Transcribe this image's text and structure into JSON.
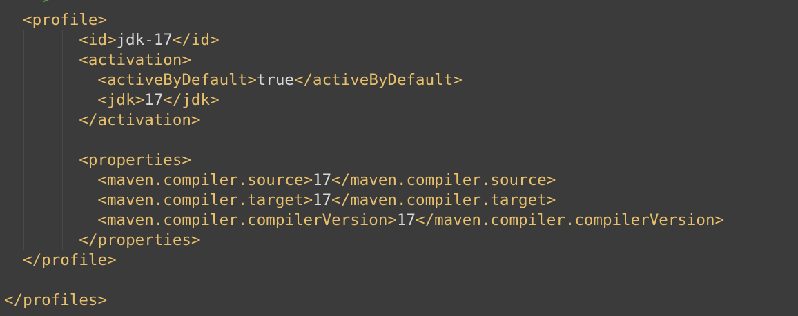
{
  "comment_tail": "-->",
  "lines": [
    {
      "indent": "  ",
      "open": "<profile>",
      "text": "",
      "close": ""
    },
    {
      "indent": "        ",
      "open": "<id>",
      "text": "jdk-17",
      "close": "</id>"
    },
    {
      "indent": "        ",
      "open": "<activation>",
      "text": "",
      "close": ""
    },
    {
      "indent": "          ",
      "open": "<activeByDefault>",
      "text": "true",
      "close": "</activeByDefault>"
    },
    {
      "indent": "          ",
      "open": "<jdk>",
      "text": "17",
      "close": "</jdk>"
    },
    {
      "indent": "        ",
      "open": "</activation>",
      "text": "",
      "close": ""
    },
    {
      "indent": "",
      "open": "",
      "text": "",
      "close": ""
    },
    {
      "indent": "        ",
      "open": "<properties>",
      "text": "",
      "close": ""
    },
    {
      "indent": "          ",
      "open": "<maven.compiler.source>",
      "text": "17",
      "close": "</maven.compiler.source>"
    },
    {
      "indent": "          ",
      "open": "<maven.compiler.target>",
      "text": "17",
      "close": "</maven.compiler.target>"
    },
    {
      "indent": "          ",
      "open": "<maven.compiler.compilerVersion>",
      "text": "17",
      "close": "</maven.compiler.compilerVersion>"
    },
    {
      "indent": "        ",
      "open": "</properties>",
      "text": "",
      "close": ""
    },
    {
      "indent": "  ",
      "open": "</profile>",
      "text": "",
      "close": ""
    },
    {
      "indent": "",
      "open": "",
      "text": "",
      "close": ""
    },
    {
      "indent": "",
      "open": "</profiles>",
      "text": "",
      "close": ""
    }
  ]
}
